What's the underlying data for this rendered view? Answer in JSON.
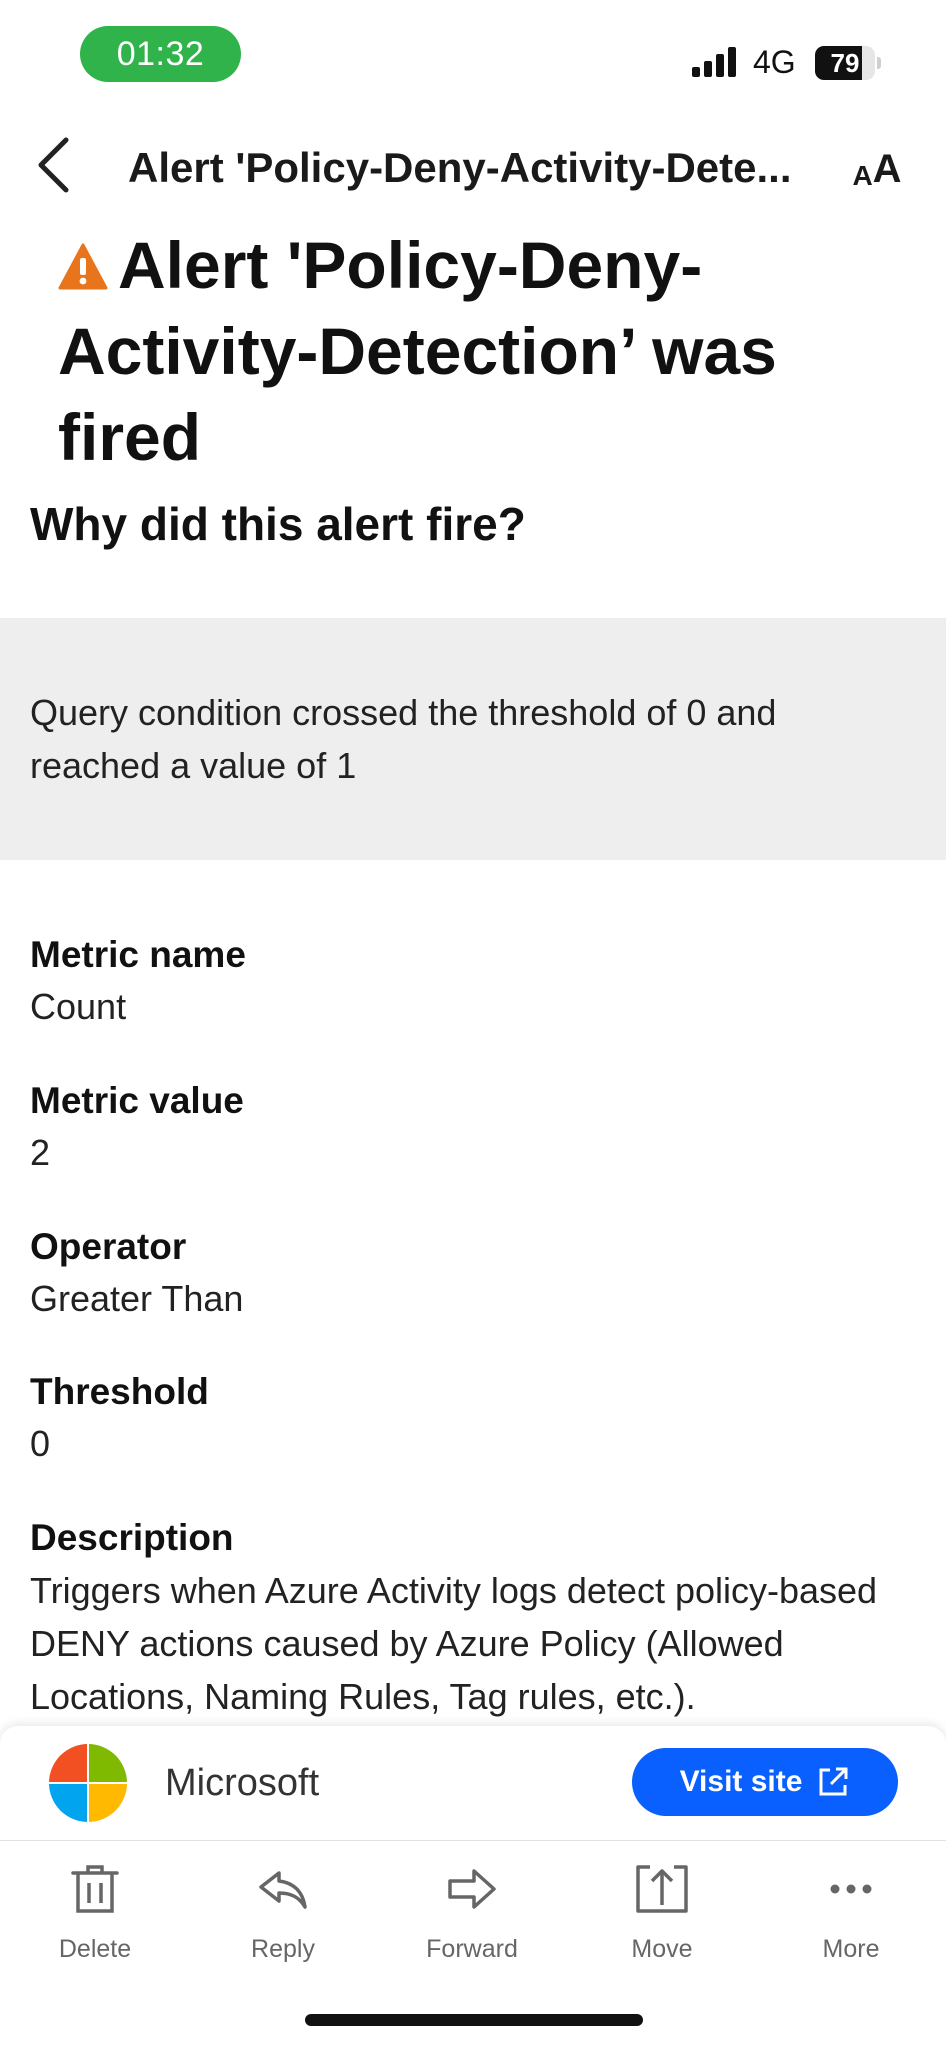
{
  "status_bar": {
    "time": "01:32",
    "network": "4G",
    "battery_level": "79",
    "battery_fraction": 0.79,
    "time_pill_color": "#2fb34a"
  },
  "nav": {
    "back_icon": "chevron-left-icon",
    "title": "Alert 'Policy-Deny-Activity-Dete...",
    "text_size_small": "A",
    "text_size_big": "A"
  },
  "email": {
    "headline": "Alert 'Policy-Deny-Activity-Detection’ was fired",
    "headline_icon": "warning-icon",
    "why_heading": "Why did this alert fire?",
    "condition_text": "Query condition crossed the threshold of 0 and reached a value of 1",
    "fields": [
      {
        "label": "Metric name",
        "value": "Count"
      },
      {
        "label": "Metric value",
        "value": "2"
      },
      {
        "label": "Operator",
        "value": "Greater Than"
      },
      {
        "label": "Threshold",
        "value": "0"
      },
      {
        "label": "Description",
        "value": "Triggers when Azure Activity logs detect policy-based DENY actions caused by Azure Policy (Allowed Locations, Naming Rules, Tag rules, etc.)."
      }
    ]
  },
  "ad": {
    "name": "Microsoft",
    "button_label": "Visit site",
    "button_icon": "external-link-icon",
    "button_color": "#0a5fff"
  },
  "toolbar": {
    "items": [
      {
        "label": "Delete",
        "icon": "trash-icon"
      },
      {
        "label": "Reply",
        "icon": "reply-icon"
      },
      {
        "label": "Forward",
        "icon": "forward-icon"
      },
      {
        "label": "Move",
        "icon": "move-icon"
      },
      {
        "label": "More",
        "icon": "more-icon"
      }
    ]
  }
}
